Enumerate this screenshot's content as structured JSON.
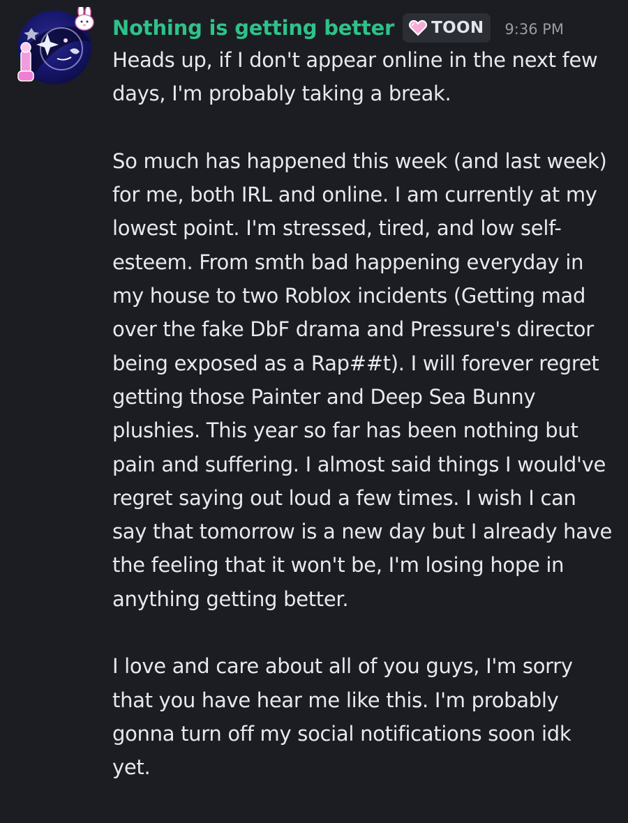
{
  "message": {
    "author": "Nothing is getting better",
    "tag": {
      "icon": "pink-heart-icon",
      "label": "TOON"
    },
    "timestamp": "9:36 PM",
    "paragraphs": [
      "Heads up, if I don't appear online in the next few days, I'm probably taking a break.",
      "So much has happened this week (and last week) for me, both IRL and online. I am currently at my lowest point. I'm stressed, tired, and low self-esteem. From smth bad happening everyday in my house to two Roblox incidents (Getting mad over the fake DbF drama and Pressure's director being exposed as a Rap##t). I will forever regret getting those Painter and Deep Sea Bunny plushies. This year so far has been nothing but pain and suffering. I almost said things I would've regret saying out loud a few times. I wish I can say that tomorrow is a new day but I already have the feeling that it won't be, I'm losing hope in anything getting better.",
      "I love and care about all of you guys, I'm sorry that you have hear me like this. I'm probably gonna turn off my social notifications soon idk yet."
    ]
  },
  "colors": {
    "background": "#1c1d22",
    "username": "#2ec28a",
    "text": "#e8e9ee",
    "timestamp": "#9a9ca4",
    "tag_background": "#2c2e35"
  }
}
